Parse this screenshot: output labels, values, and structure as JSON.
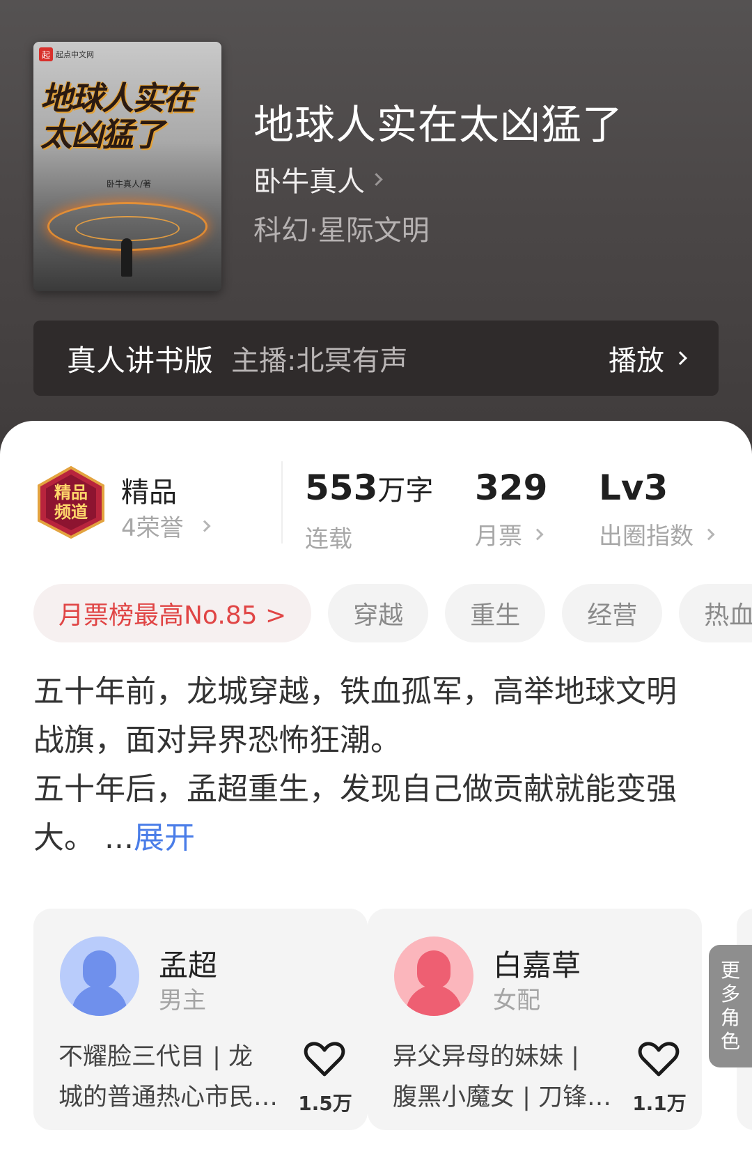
{
  "book": {
    "title": "地球人实在太凶猛了",
    "author": "卧牛真人",
    "genre": "科幻·星际文明",
    "cover": {
      "publisher_logo": "起点中文网",
      "logo_char": "起",
      "title_line1": "地球人实在",
      "title_line2": "太凶猛了",
      "author": "卧牛真人/著"
    }
  },
  "audio": {
    "label": "真人讲书版",
    "host": "主播:北冥有声",
    "play_label": "播放"
  },
  "stats": {
    "badge_text_1": "精品",
    "badge_text_2": "频道",
    "premium_label": "精品",
    "honors": "4荣誉",
    "word_count_number": "553",
    "word_count_unit": "万字",
    "status": "连载",
    "monthly_tickets": "329",
    "monthly_tickets_label": "月票",
    "breakout_level": "Lv3",
    "breakout_label": "出圈指数"
  },
  "tags": {
    "rank": "月票榜最高No.85 >",
    "items": [
      "穿越",
      "重生",
      "经营",
      "热血"
    ]
  },
  "synopsis": {
    "p1": "五十年前，龙城穿越，铁血孤军，高举地球文明战旗，面对异界恐怖狂潮。",
    "p2": "五十年后，孟超重生，发现自己做贡献就能变强大。 ...",
    "expand": "展开"
  },
  "characters": [
    {
      "name": "孟超",
      "role": "男主",
      "desc_line1": "不耀脸三代目 | 龙",
      "desc_line2": "城的普通热心市民…",
      "likes": "1.5万",
      "avatar_color": "#8aa8f5"
    },
    {
      "name": "白嘉草",
      "role": "女配",
      "desc_line1": "异父异母的妹妹 |",
      "desc_line2": "腹黑小魔女 | 刀锋…",
      "likes": "1.1万",
      "avatar_color": "#f59aa4"
    }
  ],
  "more_roles": [
    "更",
    "多",
    "角",
    "色"
  ],
  "colors": {
    "header_bg": "#4b4747",
    "audio_bar_bg": "#2f2b2b",
    "rank_tag_text": "#e04545",
    "expand_link": "#4a7de8"
  }
}
